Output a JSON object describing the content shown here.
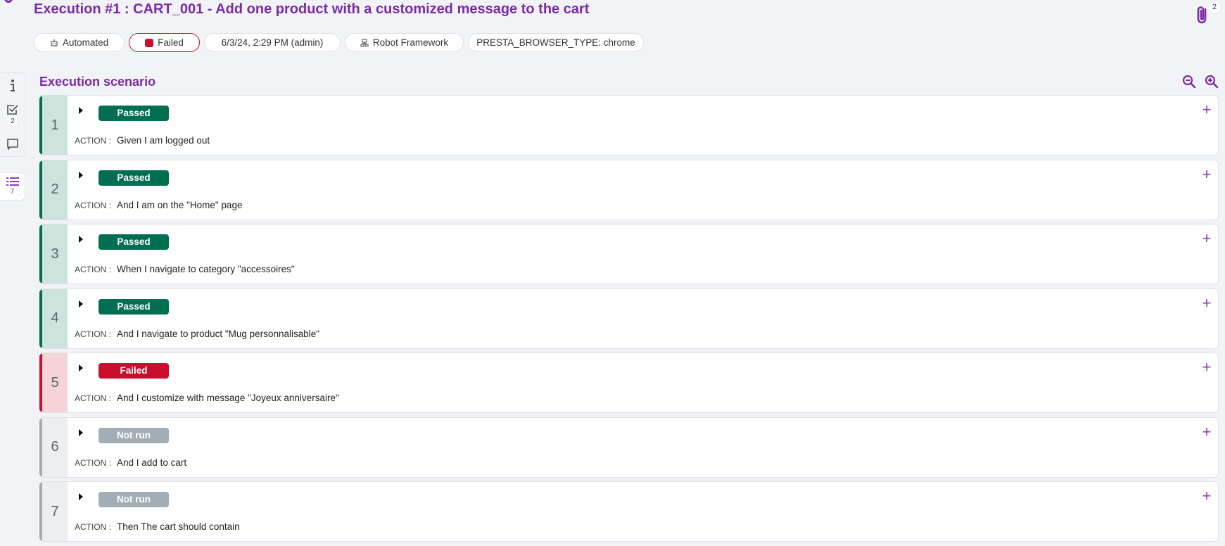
{
  "header": {
    "title": "Execution #1 : CART_001 - Add one product with a customized message to the cart",
    "attachments_count": "2",
    "chips": [
      {
        "icon": "robot-icon",
        "label": "Automated"
      },
      {
        "icon": "status-square-icon",
        "label": "Failed"
      },
      {
        "icon": "",
        "label": "6/3/24, 2:29 PM (admin)"
      },
      {
        "icon": "framework-icon",
        "label": "Robot Framework"
      },
      {
        "icon": "",
        "label": "PRESTA_BROWSER_TYPE: chrome"
      }
    ]
  },
  "sidebar": {
    "items": [
      {
        "icon": "info-icon",
        "badge": ""
      },
      {
        "icon": "checklist-icon",
        "badge": "2"
      },
      {
        "icon": "comment-icon",
        "badge": ""
      },
      {
        "icon": "numbered-list-icon",
        "badge": "7"
      }
    ]
  },
  "section": {
    "title": "Execution scenario",
    "zoom_out": "zoom-out-icon",
    "zoom_in": "zoom-in-icon"
  },
  "colors": {
    "accent": "#7b2aa8",
    "passed": "#006e52",
    "failed": "#c8102e",
    "not_run": "#a3adb5"
  },
  "steps": [
    {
      "number": "1",
      "status": "Passed",
      "action_label": "ACTION :",
      "action": "Given I am logged out"
    },
    {
      "number": "2",
      "status": "Passed",
      "action_label": "ACTION :",
      "action": "And I am on the \"Home\" page"
    },
    {
      "number": "3",
      "status": "Passed",
      "action_label": "ACTION :",
      "action": "When I navigate to category \"accessoires\""
    },
    {
      "number": "4",
      "status": "Passed",
      "action_label": "ACTION :",
      "action": "And I navigate to product \"Mug personnalisable\""
    },
    {
      "number": "5",
      "status": "Failed",
      "action_label": "ACTION :",
      "action": "And I customize with message \"Joyeux anniversaire\""
    },
    {
      "number": "6",
      "status": "Not run",
      "action_label": "ACTION :",
      "action": "And I add to cart"
    },
    {
      "number": "7",
      "status": "Not run",
      "action_label": "ACTION :",
      "action": "Then The cart should contain"
    }
  ]
}
